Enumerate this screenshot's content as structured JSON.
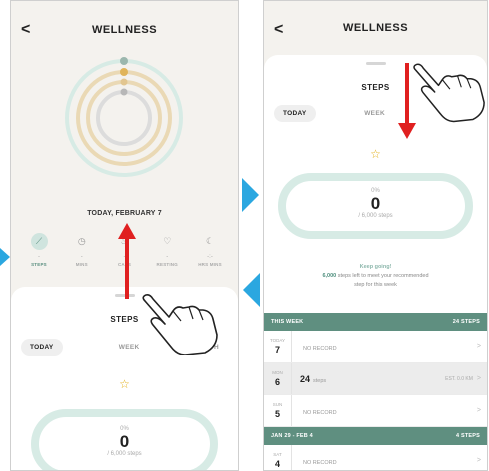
{
  "left": {
    "title": "WELLNESS",
    "back": "<",
    "date": "TODAY, FEBRUARY 7",
    "metrics": [
      {
        "icon": "shoe-icon",
        "glyph": "⟋",
        "value": "-",
        "label": "STEPS"
      },
      {
        "icon": "clock-icon",
        "glyph": "◷",
        "value": "-",
        "label": "MINS"
      },
      {
        "icon": "flame-icon",
        "glyph": "♨",
        "value": "-",
        "label": "CALS"
      },
      {
        "icon": "heart-icon",
        "glyph": "♡",
        "value": "-",
        "label": "RESTING"
      },
      {
        "icon": "moon-icon",
        "glyph": "☾",
        "value": "-:-",
        "label": "HRS MINS"
      }
    ],
    "sheet": {
      "title": "STEPS",
      "tabs": [
        "TODAY",
        "WEEK",
        "MONTH"
      ],
      "tab_visible": [
        "TODAY",
        "WEEK",
        "NTH"
      ],
      "percent": "0%",
      "steps": "0",
      "goal": "/ 6,000 steps"
    }
  },
  "right": {
    "title": "WELLNESS",
    "back": "<",
    "sheet": {
      "title": "STEPS",
      "tabs": [
        "TODAY",
        "WEEK",
        "MONTH"
      ],
      "tab_visible": [
        "TODAY",
        "WEEK",
        "MONTH"
      ],
      "percent": "0%",
      "steps": "0",
      "goal": "/ 6,000 steps",
      "keep_head": "Keep going!",
      "keep_count": "6,000",
      "keep_text_1": "steps left to meet your recommended",
      "keep_text_2": "step for this week"
    },
    "list": {
      "sections": [
        {
          "name": "THIS WEEK",
          "total": "24 STEPS",
          "rows": [
            {
              "day": "TODAY",
              "num": "7",
              "value": "",
              "note": "NO RECORD",
              "est": ""
            },
            {
              "day": "MON",
              "num": "6",
              "value": "24",
              "note": "steps",
              "est": "EST. 0.0 KM"
            },
            {
              "day": "SUN",
              "num": "5",
              "value": "",
              "note": "NO RECORD",
              "est": ""
            }
          ]
        },
        {
          "name": "JAN 29 - FEB 4",
          "total": "4 STEPS",
          "rows": [
            {
              "day": "SAT",
              "num": "4",
              "value": "",
              "note": "NO RECORD",
              "est": ""
            }
          ]
        }
      ]
    }
  },
  "colors": {
    "accent": "#5f8f80",
    "ring_outer": "#d7ebe5",
    "ring_mid": "#ead9b5",
    "arrow": "#e02020",
    "indicator": "#2ba7e0",
    "star": "#e3b11a"
  }
}
